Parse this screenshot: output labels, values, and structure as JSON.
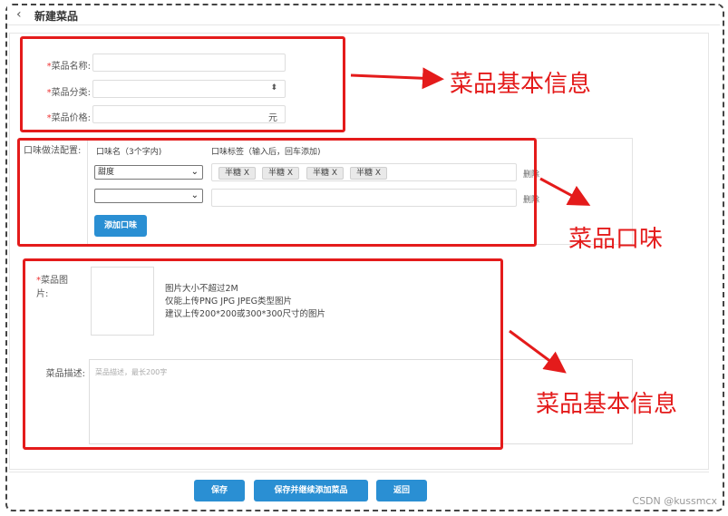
{
  "header": {
    "back_icon": "‹",
    "title": "新建菜品"
  },
  "basic": {
    "name_label": "菜品名称:",
    "category_label": "菜品分类:",
    "price_label": "菜品价格:",
    "price_suffix": "元",
    "required_mark": "*",
    "category_caret": "⬍"
  },
  "flavor": {
    "section_label": "口味做法配置:",
    "col_name": "口味名（3个字内)",
    "col_tags": "口味标签（输入后，回车添加)",
    "rows": [
      {
        "select_value": "甜度",
        "tags": [
          "半糖 X",
          "半糖 X",
          "半糖 X",
          "半糖 X"
        ],
        "delete": "删除"
      },
      {
        "select_value": "",
        "tags": [],
        "delete": "删除"
      }
    ],
    "add_button": "添加口味"
  },
  "image": {
    "label_line1": "菜品图",
    "label_line2": "片:",
    "hints": [
      "图片大小不超过2M",
      "仅能上传PNG JPG JPEG类型图片",
      "建议上传200*200或300*300尺寸的图片"
    ]
  },
  "desc": {
    "label": "菜品描述:",
    "placeholder": "菜品描述，最长200字"
  },
  "footer": {
    "save": "保存",
    "save_continue": "保存并继续添加菜品",
    "back": "返回"
  },
  "annotations": {
    "basic_top": "菜品基本信息",
    "flavor": "菜品口味",
    "basic_bottom": "菜品基本信息",
    "color": "#e41b1b"
  },
  "watermark": "CSDN @kussmcx"
}
